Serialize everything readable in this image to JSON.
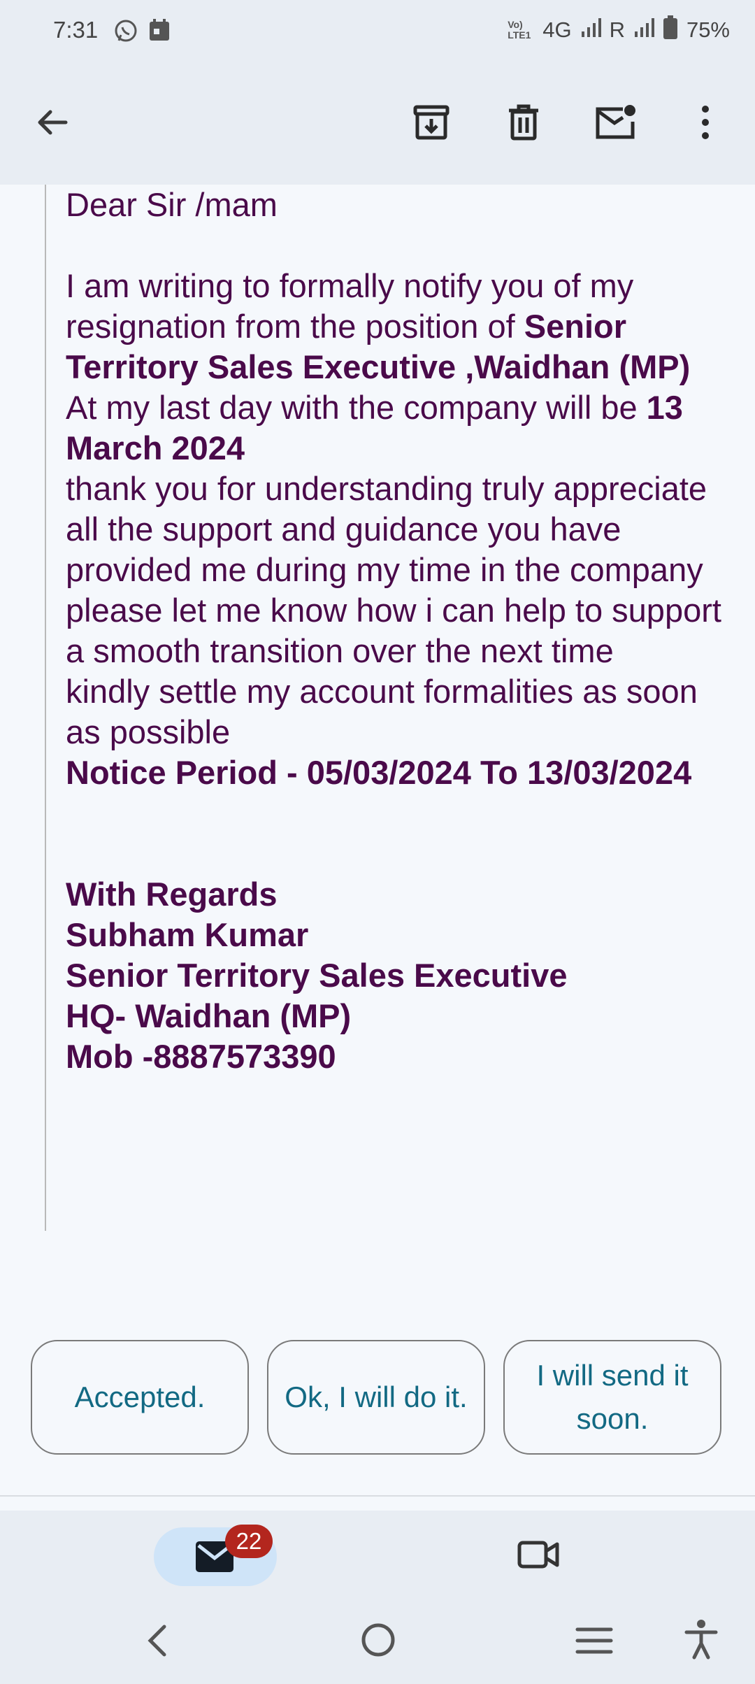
{
  "status_bar": {
    "time": "7:31",
    "network": "4G",
    "roaming": "R",
    "battery": "75%",
    "volte": "Vo) LTE1"
  },
  "toolbar": {
    "back_icon": "arrow-back-icon",
    "archive_icon": "archive-icon",
    "delete_icon": "trash-icon",
    "mark_unread_icon": "mark-unread-icon",
    "more_icon": "more-vert-icon"
  },
  "email": {
    "greeting": "Dear Sir /mam",
    "p1_a": "I am writing to formally notify you of my resignation from the position of ",
    "p1_position": "Senior Territory Sales Executive ,Waidhan (MP)",
    "p2_a": "At my last day with the company will be ",
    "p2_date": "13 March 2024",
    "p3": "thank you for understanding truly appreciate all the support and guidance you have provided me during my time in the company",
    "p4": "please let me know how i can help to support a smooth transition over the next time",
    "p5": "kindly settle my account formalities as soon as possible",
    "notice": "Notice Period - 05/03/2024 To 13/03/2024",
    "sign_regards": "With Regards",
    "sign_name": "Subham Kumar",
    "sign_title": "Senior Territory Sales Executive",
    "sign_hq": "HQ- Waidhan (MP)",
    "sign_mob": "Mob -8887573390"
  },
  "smart_replies": [
    "Accepted.",
    "Ok, I will do it.",
    "I will send it soon."
  ],
  "bottom_nav": {
    "mail_badge": "22",
    "mail_icon": "mail-icon",
    "meet_icon": "video-icon"
  },
  "colors": {
    "body_text": "#4a0a4a",
    "chip_text": "#126983",
    "badge": "#b3261e",
    "bar_bg": "#e8edf3"
  }
}
